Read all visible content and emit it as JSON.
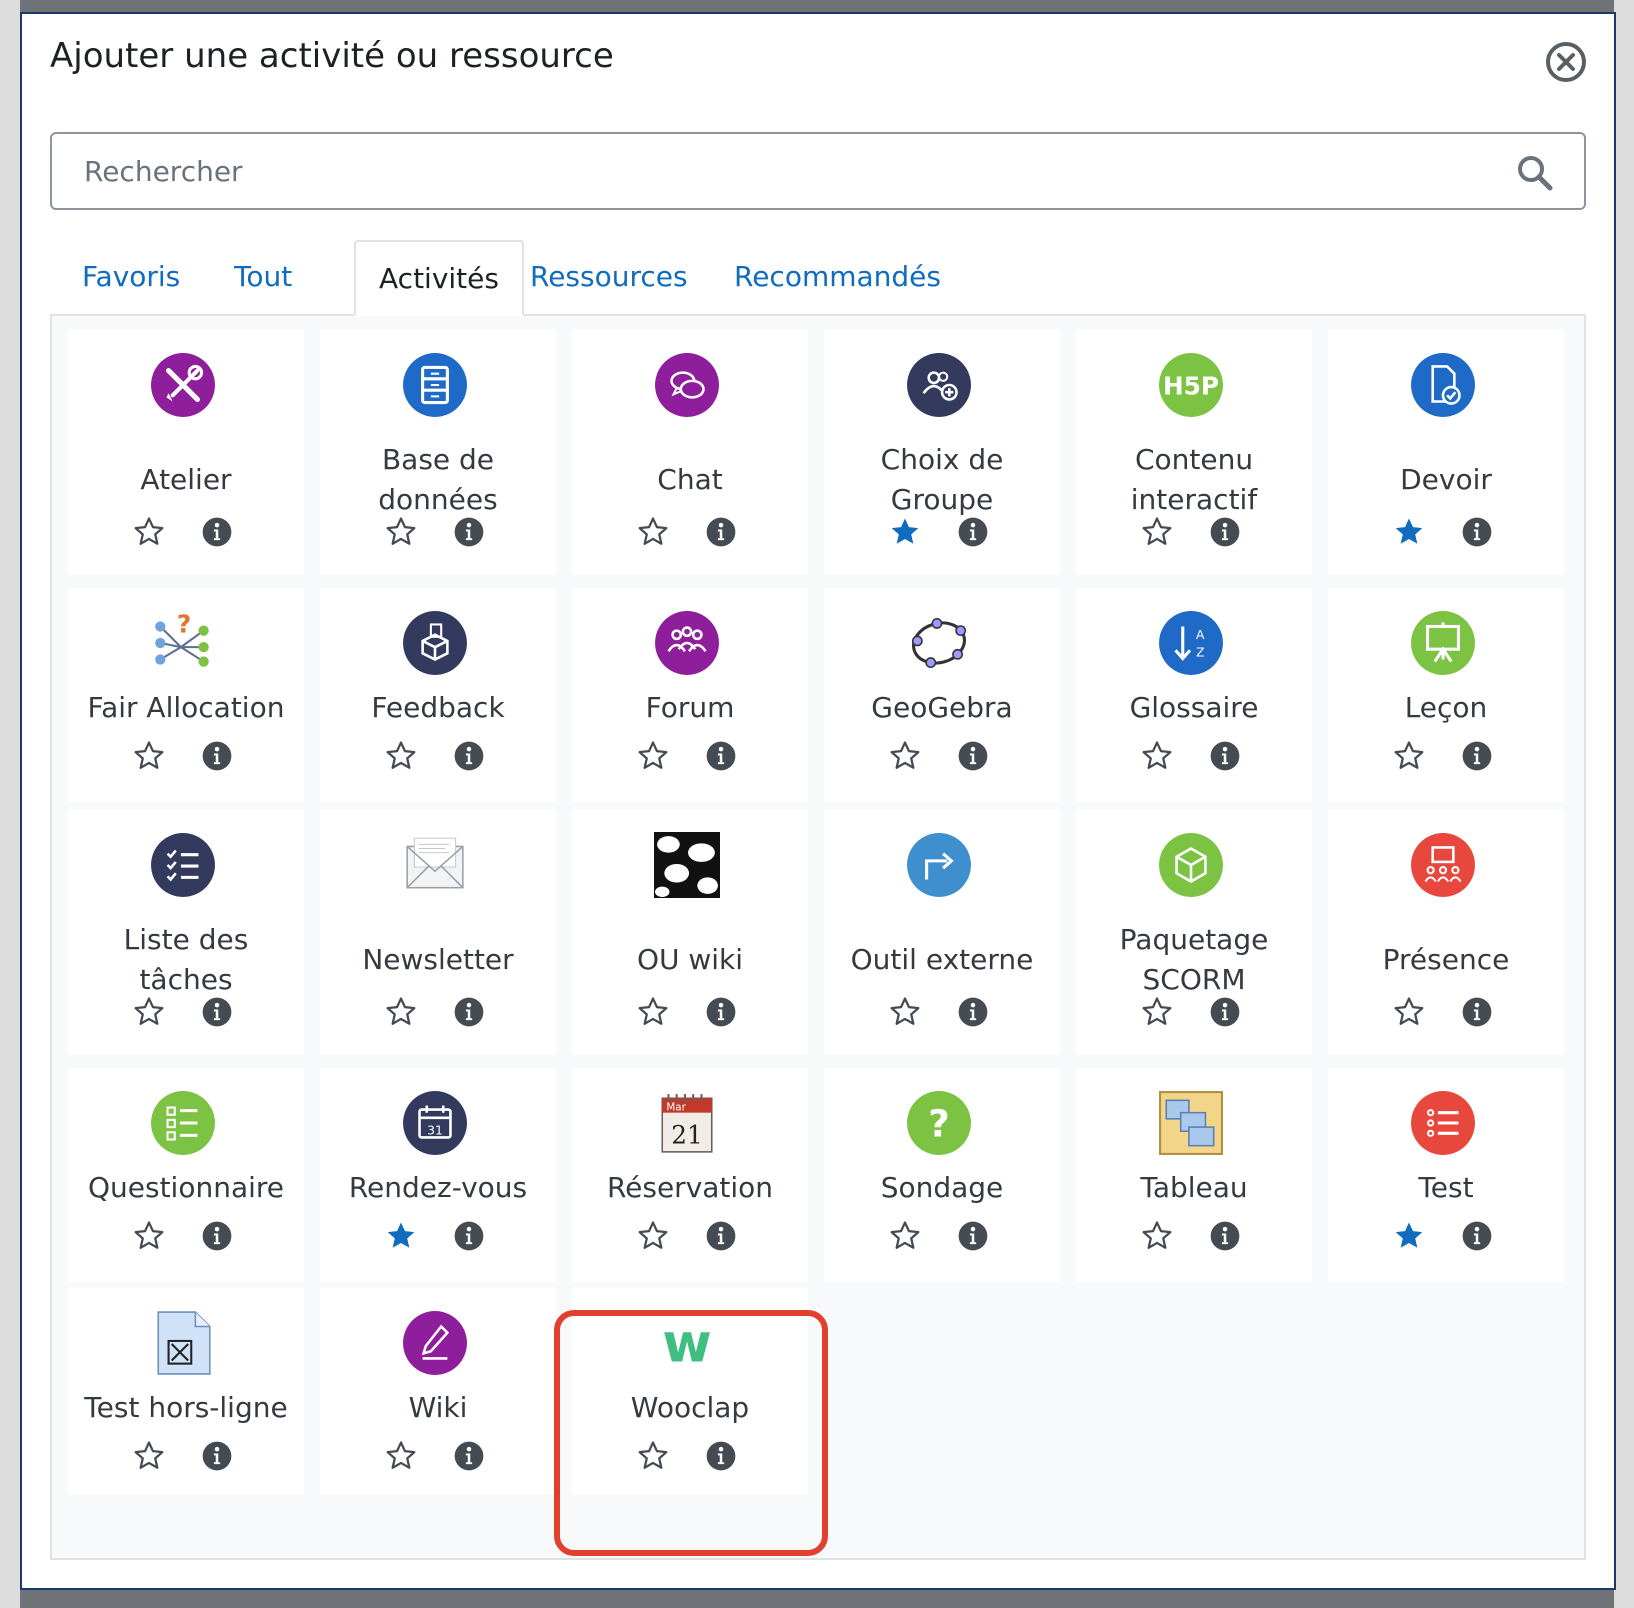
{
  "modal": {
    "title": "Ajouter une activité ou ressource"
  },
  "search": {
    "placeholder": "Rechercher"
  },
  "tabs": [
    {
      "label": "Favoris",
      "active": false
    },
    {
      "label": "Tout",
      "active": false
    },
    {
      "label": "Activités",
      "active": true
    },
    {
      "label": "Ressources",
      "active": false
    },
    {
      "label": "Recommandés",
      "active": false
    }
  ],
  "colors": {
    "link": "#0f6cbf",
    "star_filled": "#0f6cbf",
    "highlight": "#e2402f",
    "purple": "#8e1e9b",
    "blue": "#1f6ac6",
    "navy": "#333a5e",
    "green": "#7cc243",
    "red": "#e8473e",
    "lightblue": "#3f8fcf"
  },
  "activities": [
    {
      "name": "Atelier",
      "icon": "tools-icon",
      "color": "#8e1e9b",
      "favorite": false
    },
    {
      "name": "Base de données",
      "icon": "database-icon",
      "color": "#1f6ac6",
      "favorite": false
    },
    {
      "name": "Chat",
      "icon": "chat-icon",
      "color": "#8e1e9b",
      "favorite": false
    },
    {
      "name": "Choix de Groupe",
      "icon": "group-choice-icon",
      "color": "#333a5e",
      "favorite": true
    },
    {
      "name": "Contenu interactif",
      "icon": "h5p-icon",
      "color": "#7cc243",
      "favorite": false
    },
    {
      "name": "Devoir",
      "icon": "assignment-icon",
      "color": "#1f6ac6",
      "favorite": true
    },
    {
      "name": "Fair Allocation",
      "icon": "fair-allocation-icon",
      "color": "#3f8fcf",
      "favorite": false
    },
    {
      "name": "Feedback",
      "icon": "feedback-icon",
      "color": "#333a5e",
      "favorite": false
    },
    {
      "name": "Forum",
      "icon": "forum-icon",
      "color": "#8e1e9b",
      "favorite": false
    },
    {
      "name": "GeoGebra",
      "icon": "geogebra-icon",
      "color": "#333333",
      "favorite": false
    },
    {
      "name": "Glossaire",
      "icon": "glossary-icon",
      "color": "#1f6ac6",
      "favorite": false
    },
    {
      "name": "Leçon",
      "icon": "lesson-icon",
      "color": "#7cc243",
      "favorite": false
    },
    {
      "name": "Liste des tâches",
      "icon": "checklist-icon",
      "color": "#333a5e",
      "favorite": false
    },
    {
      "name": "Newsletter",
      "icon": "newsletter-icon",
      "color": "#b8bcc4",
      "favorite": false
    },
    {
      "name": "OU wiki",
      "icon": "ouwiki-icon",
      "color": "#111111",
      "favorite": false
    },
    {
      "name": "Outil externe",
      "icon": "external-tool-icon",
      "color": "#3f8fcf",
      "favorite": false
    },
    {
      "name": "Paquetage SCORM",
      "icon": "scorm-icon",
      "color": "#7cc243",
      "favorite": false
    },
    {
      "name": "Présence",
      "icon": "attendance-icon",
      "color": "#e8473e",
      "favorite": false
    },
    {
      "name": "Questionnaire",
      "icon": "questionnaire-icon",
      "color": "#7cc243",
      "favorite": false
    },
    {
      "name": "Rendez-vous",
      "icon": "scheduler-icon",
      "color": "#333a5e",
      "favorite": true
    },
    {
      "name": "Réservation",
      "icon": "calendar-icon",
      "color": "#c0392b",
      "calendar_month": "Mar",
      "calendar_day": "21",
      "favorite": false
    },
    {
      "name": "Sondage",
      "icon": "question-mark-icon",
      "color": "#7cc243",
      "favorite": false
    },
    {
      "name": "Tableau",
      "icon": "board-icon",
      "color": "#f3d58a",
      "favorite": false
    },
    {
      "name": "Test",
      "icon": "quiz-icon",
      "color": "#e8473e",
      "favorite": true
    },
    {
      "name": "Test hors-ligne",
      "icon": "offline-quiz-icon",
      "color": "#cfe2f7",
      "favorite": false
    },
    {
      "name": "Wiki",
      "icon": "wiki-icon",
      "color": "#8e1e9b",
      "favorite": false
    },
    {
      "name": "Wooclap",
      "icon": "wooclap-icon",
      "color": "#3fbf7f",
      "letter": "w",
      "favorite": false,
      "highlighted": true
    }
  ]
}
